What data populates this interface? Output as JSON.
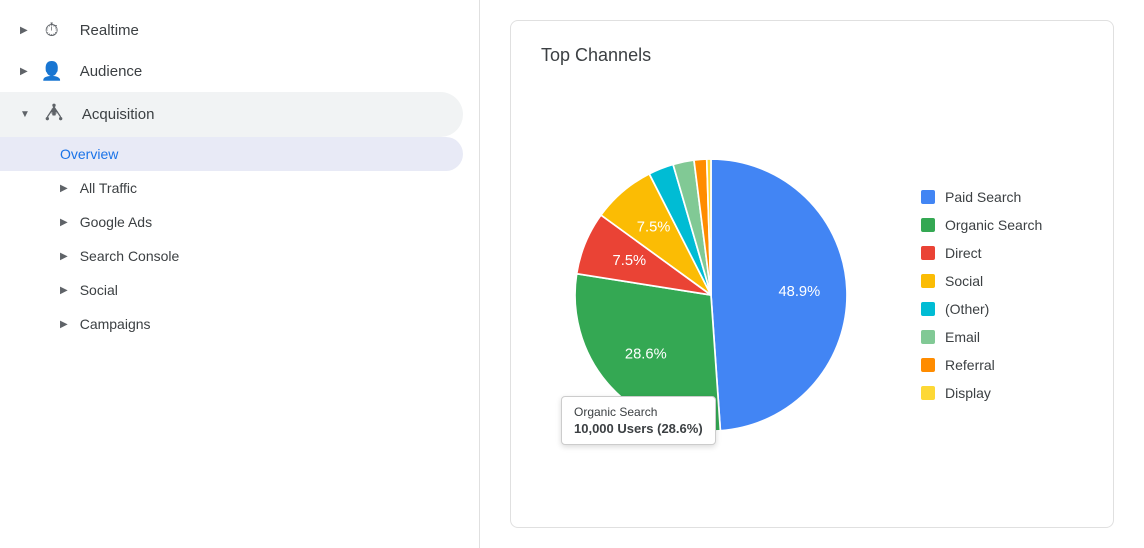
{
  "sidebar": {
    "items": [
      {
        "id": "realtime",
        "icon": "⏱",
        "label": "Realtime",
        "has_arrow": true,
        "expanded": false
      },
      {
        "id": "audience",
        "icon": "👤",
        "label": "Audience",
        "has_arrow": true,
        "expanded": false
      },
      {
        "id": "acquisition",
        "icon": "⇄",
        "label": "Acquisition",
        "has_arrow": true,
        "expanded": true
      }
    ],
    "subitems": [
      {
        "id": "overview",
        "label": "Overview",
        "active": true,
        "has_arrow": false
      },
      {
        "id": "all-traffic",
        "label": "All Traffic",
        "has_arrow": true
      },
      {
        "id": "google-ads",
        "label": "Google Ads",
        "has_arrow": true
      },
      {
        "id": "search-console",
        "label": "Search Console",
        "has_arrow": true
      },
      {
        "id": "social",
        "label": "Social",
        "has_arrow": true
      },
      {
        "id": "campaigns",
        "label": "Campaigns",
        "has_arrow": true
      }
    ]
  },
  "chart": {
    "title": "Top Channels",
    "tooltip": {
      "title": "Organic Search",
      "value": "10,000 Users (28.6%)"
    },
    "segments": [
      {
        "id": "paid-search",
        "label": "Paid Search",
        "percent": 48.9,
        "color": "#4285f4"
      },
      {
        "id": "organic-search",
        "label": "Organic Search",
        "percent": 28.6,
        "color": "#34a853"
      },
      {
        "id": "direct",
        "label": "Direct",
        "percent": 7.5,
        "color": "#ea4335"
      },
      {
        "id": "social",
        "label": "Social",
        "percent": 7.5,
        "color": "#fbbc04"
      },
      {
        "id": "other",
        "label": "(Other)",
        "percent": 3.0,
        "color": "#00bcd4"
      },
      {
        "id": "email",
        "label": "Email",
        "percent": 2.5,
        "color": "#81c995"
      },
      {
        "id": "referral",
        "label": "Referral",
        "percent": 1.5,
        "color": "#ff8c00"
      },
      {
        "id": "display",
        "label": "Display",
        "percent": 0.5,
        "color": "#fdd835"
      }
    ],
    "labels": [
      {
        "segment": "paid-search",
        "value": "48.9%"
      },
      {
        "segment": "organic-search",
        "value": "28.6%"
      },
      {
        "segment": "direct",
        "value": "7.5%"
      },
      {
        "segment": "social",
        "value": "7.5%"
      }
    ]
  }
}
